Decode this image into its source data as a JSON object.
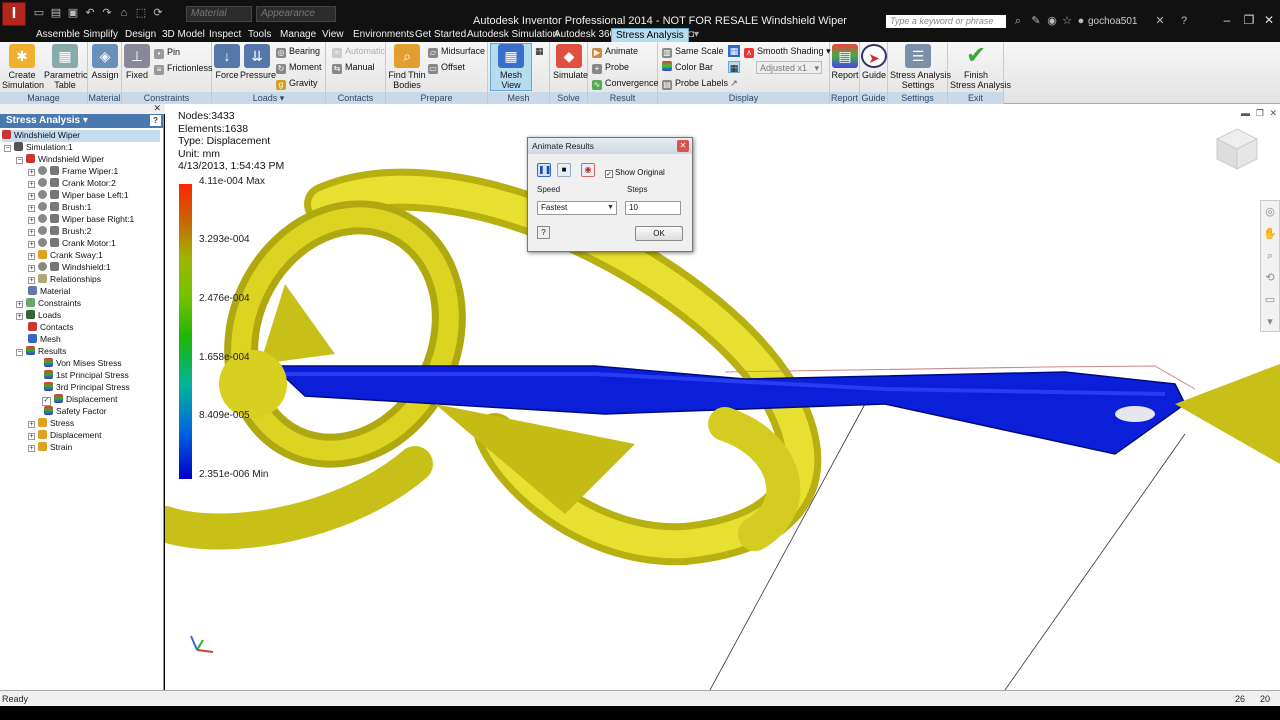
{
  "titlebar": {
    "app_letter": "I",
    "material_placeholder": "Material",
    "appearance_placeholder": "Appearance",
    "title": "Autodesk Inventor Professional 2014 - NOT FOR RESALE   Windshield Wiper",
    "search_placeholder": "Type a keyword or phrase",
    "user": "gochoa501"
  },
  "tabs": [
    "Assemble",
    "Simplify",
    "Design",
    "3D Model",
    "Inspect",
    "Tools",
    "Manage",
    "View",
    "Environments",
    "Get Started",
    "Autodesk Simulation",
    "Autodesk 360",
    "Stress Analysis"
  ],
  "ribbon": {
    "manage": {
      "label": "Manage",
      "create": "Create\nSimulation",
      "param": "Parametric\nTable"
    },
    "material": {
      "label": "Material",
      "assign": "Assign"
    },
    "constraints": {
      "label": "Constraints",
      "fixed": "Fixed",
      "pin": "Pin",
      "frictionless": "Frictionless"
    },
    "loads": {
      "label": "Loads",
      "force": "Force",
      "pressure": "Pressure",
      "bearing": "Bearing",
      "moment": "Moment",
      "gravity": "Gravity"
    },
    "contacts": {
      "label": "Contacts",
      "automatic": "Automatic",
      "manual": "Manual"
    },
    "prepare": {
      "label": "Prepare",
      "find_thin": "Find Thin\nBodies",
      "midsurface": "Midsurface",
      "offset": "Offset"
    },
    "mesh": {
      "label": "Mesh",
      "mesh_view": "Mesh View"
    },
    "solve": {
      "label": "Solve",
      "simulate": "Simulate"
    },
    "result": {
      "label": "Result",
      "animate": "Animate",
      "probe": "Probe",
      "convergence": "Convergence"
    },
    "display": {
      "label": "Display",
      "same_scale": "Same Scale",
      "color_bar": "Color Bar",
      "probe_labels": "Probe Labels",
      "shading": "Smooth Shading",
      "adjusted": "Adjusted x1"
    },
    "report": {
      "label": "Report",
      "report": "Report"
    },
    "guide": {
      "label": "Guide",
      "guide": "Guide"
    },
    "settings": {
      "label": "Settings",
      "settings": "Stress Analysis\nSettings"
    },
    "exit": {
      "label": "Exit",
      "finish": "Finish\nStress Analysis"
    }
  },
  "browser": {
    "title": "Stress Analysis",
    "items": [
      {
        "label": "Windshield Wiper"
      },
      {
        "label": "Simulation:1"
      },
      {
        "label": "Windshield Wiper"
      },
      {
        "label": "Frame Wiper:1"
      },
      {
        "label": "Crank Motor:2"
      },
      {
        "label": "Wiper base Left:1"
      },
      {
        "label": "Brush:1"
      },
      {
        "label": "Wiper base Right:1"
      },
      {
        "label": "Brush:2"
      },
      {
        "label": "Crank Motor:1"
      },
      {
        "label": "Crank Sway:1"
      },
      {
        "label": "Windshield:1"
      },
      {
        "label": "Relationships"
      },
      {
        "label": "Material"
      },
      {
        "label": "Constraints"
      },
      {
        "label": "Loads"
      },
      {
        "label": "Contacts"
      },
      {
        "label": "Mesh"
      },
      {
        "label": "Results"
      },
      {
        "label": "Von Mises Stress"
      },
      {
        "label": "1st Principal Stress"
      },
      {
        "label": "3rd Principal Stress"
      },
      {
        "label": "Displacement"
      },
      {
        "label": "Safety Factor"
      },
      {
        "label": "Stress"
      },
      {
        "label": "Displacement"
      },
      {
        "label": "Strain"
      }
    ]
  },
  "viewport": {
    "nodes": "Nodes:3433",
    "elements": "Elements:1638",
    "type": "Type: Displacement",
    "unit": "Unit: mm",
    "datetime": "4/13/2013, 1:54:43 PM",
    "legend": [
      "4.11e-004 Max",
      "3.293e-004",
      "2.476e-004",
      "1.658e-004",
      "8.409e-005",
      "2.351e-006 Min"
    ]
  },
  "dialog": {
    "title": "Animate Results",
    "show_original": "Show Original",
    "speed_label": "Speed",
    "steps_label": "Steps",
    "speed_value": "Fastest",
    "steps_value": "10",
    "ok": "OK",
    "help": "?"
  },
  "statusbar": {
    "text": "Ready",
    "n1": "26",
    "n2": "20"
  }
}
